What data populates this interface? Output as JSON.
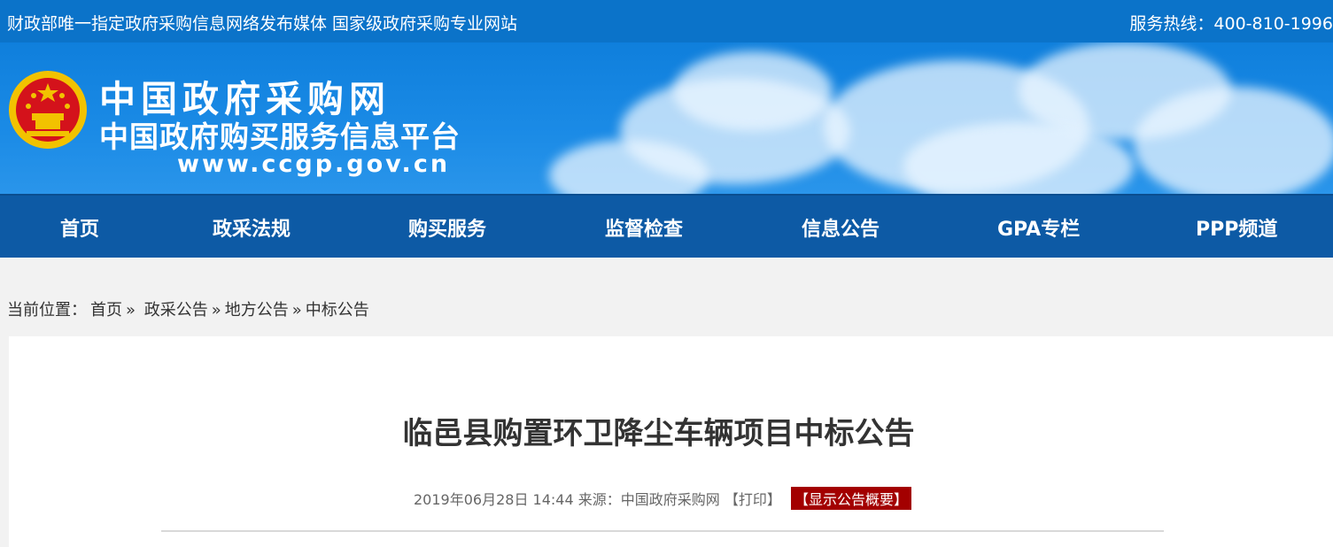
{
  "topbar": {
    "slogan": "财政部唯一指定政府采购信息网络发布媒体 国家级政府采购专业网站",
    "hotline": "服务热线：400-810-1996"
  },
  "banner": {
    "title": "中国政府采购网",
    "subtitle": "中国政府购买服务信息平台",
    "url": "www.ccgp.gov.cn",
    "emblem_icon": "national-emblem-icon"
  },
  "nav": {
    "items": [
      "首页",
      "政采法规",
      "购买服务",
      "监督检查",
      "信息公告",
      "GPA专栏",
      "PPP频道"
    ]
  },
  "breadcrumb": {
    "prefix": "当前位置：",
    "items": [
      "首页",
      "政采公告",
      "地方公告",
      "中标公告"
    ],
    "separator": "»"
  },
  "article": {
    "title": "临邑县购置环卫降尘车辆项目中标公告",
    "datetime": "2019年06月28日 14:44",
    "source_label": "来源：",
    "source": "中国政府采购网",
    "print_label": "【打印】",
    "summary_label": "【显示公告概要】"
  },
  "colors": {
    "topbar": "#0b73c9",
    "nav": "#0d5aa5",
    "summary_badge": "#a30000"
  }
}
